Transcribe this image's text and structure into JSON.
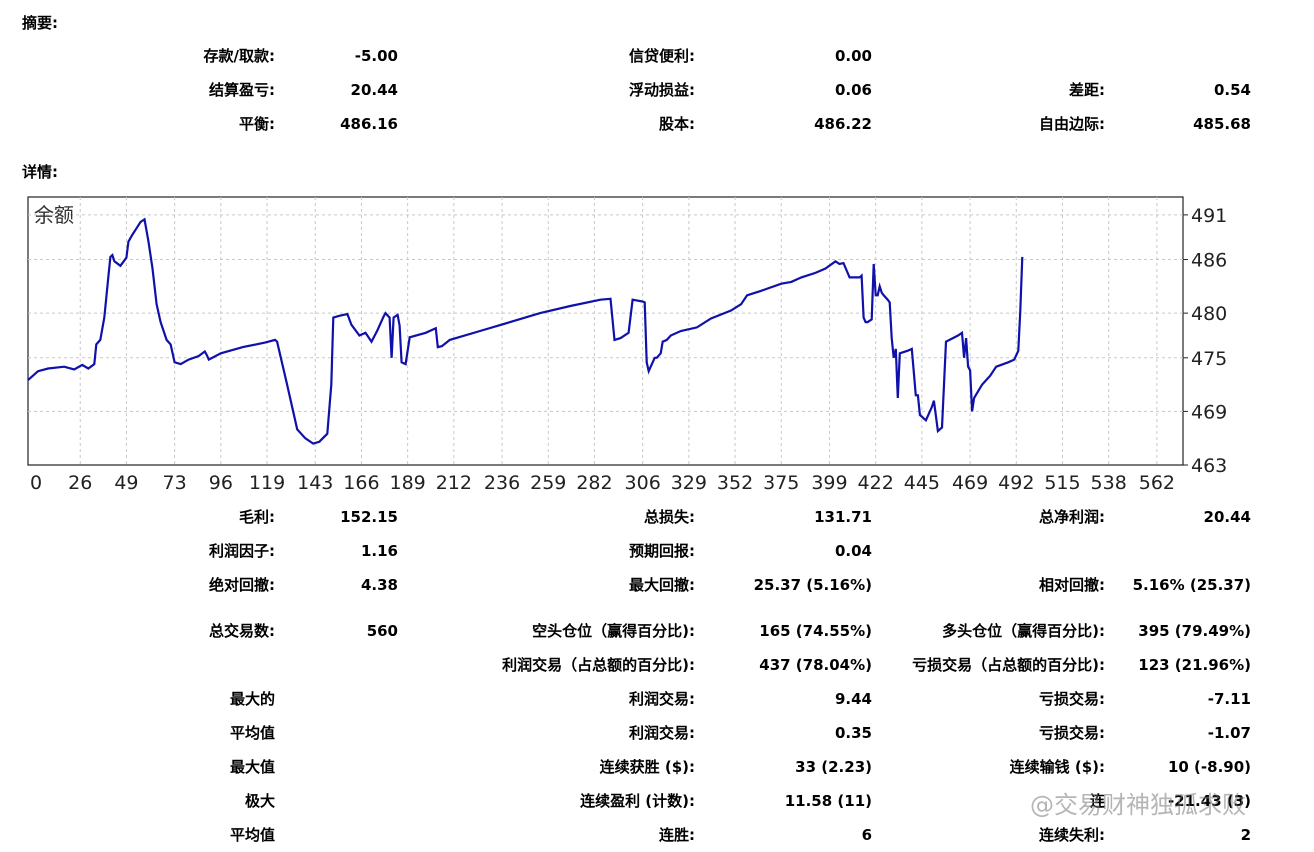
{
  "summary": {
    "heading": "摘要:",
    "rows": [
      [
        {
          "label": "存款/取款:",
          "value": "-5.00"
        },
        {
          "label": "信贷便利:",
          "value": "0.00"
        },
        {
          "label": "",
          "value": ""
        }
      ],
      [
        {
          "label": "结算盈亏:",
          "value": "20.44"
        },
        {
          "label": "浮动损益:",
          "value": "0.06"
        },
        {
          "label": "差距:",
          "value": "0.54"
        }
      ],
      [
        {
          "label": "平衡:",
          "value": "486.16"
        },
        {
          "label": "股本:",
          "value": "486.22"
        },
        {
          "label": "自由边际:",
          "value": "485.68"
        }
      ]
    ]
  },
  "details": {
    "heading": "详情:",
    "rows": [
      [
        {
          "label": "毛利:",
          "value": "152.15"
        },
        {
          "label": "总损失:",
          "value": "131.71"
        },
        {
          "label": "总净利润:",
          "value": "20.44"
        }
      ],
      [
        {
          "label": "利润因子:",
          "value": "1.16"
        },
        {
          "label": "预期回报:",
          "value": "0.04"
        },
        {
          "label": "",
          "value": ""
        }
      ],
      [
        {
          "label": "绝对回撤:",
          "value": "4.38"
        },
        {
          "label": "最大回撤:",
          "value": "25.37 (5.16%)"
        },
        {
          "label": "相对回撤:",
          "value": "5.16% (25.37)"
        }
      ],
      [
        {
          "label": "总交易数:",
          "value": "560"
        },
        {
          "label": "空头仓位（赢得百分比):",
          "value": "165 (74.55%)"
        },
        {
          "label": "多头仓位（赢得百分比):",
          "value": "395 (79.49%)"
        }
      ],
      [
        {
          "label": "",
          "value": ""
        },
        {
          "label": "利润交易（占总额的百分比):",
          "value": "437 (78.04%)"
        },
        {
          "label": "亏损交易（占总额的百分比):",
          "value": "123 (21.96%)"
        }
      ],
      [
        {
          "label": "最大的",
          "value": ""
        },
        {
          "label": "利润交易:",
          "value": "9.44"
        },
        {
          "label": "亏损交易:",
          "value": "-7.11"
        }
      ],
      [
        {
          "label": "平均值",
          "value": ""
        },
        {
          "label": "利润交易:",
          "value": "0.35"
        },
        {
          "label": "亏损交易:",
          "value": "-1.07"
        }
      ],
      [
        {
          "label": "最大值",
          "value": ""
        },
        {
          "label": "连续获胜 ($):",
          "value": "33 (2.23)"
        },
        {
          "label": "连续输钱 ($):",
          "value": "10 (-8.90)"
        }
      ],
      [
        {
          "label": "极大",
          "value": ""
        },
        {
          "label": "连续盈利 (计数):",
          "value": "11.58 (11)"
        },
        {
          "label": "连",
          "value": "-21.43 (3)"
        }
      ],
      [
        {
          "label": "平均值",
          "value": ""
        },
        {
          "label": "连胜:",
          "value": "6"
        },
        {
          "label": "连续失利:",
          "value": "2"
        }
      ]
    ]
  },
  "watermark": "@交易财神独孤求败",
  "chart_data": {
    "type": "line",
    "title": "余额",
    "line_color": "#1010aa",
    "grid": true,
    "xlim": [
      0,
      575
    ],
    "ylim": [
      463,
      493
    ],
    "x_ticks": [
      "0",
      "26",
      "49",
      "73",
      "96",
      "119",
      "143",
      "166",
      "189",
      "212",
      "236",
      "259",
      "282",
      "306",
      "329",
      "352",
      "375",
      "399",
      "422",
      "445",
      "469",
      "492",
      "515",
      "538",
      "562"
    ],
    "y_ticks": [
      463,
      469,
      475,
      480,
      486,
      491
    ],
    "series": [
      {
        "name": "",
        "points": [
          [
            0,
            472.5
          ],
          [
            5,
            473.5
          ],
          [
            10,
            473.8
          ],
          [
            18,
            474
          ],
          [
            23,
            473.7
          ],
          [
            27,
            474.2
          ],
          [
            30,
            473.8
          ],
          [
            33,
            474.3
          ],
          [
            34,
            476.5
          ],
          [
            36,
            477
          ],
          [
            38,
            479.5
          ],
          [
            40,
            484
          ],
          [
            41,
            486.3
          ],
          [
            42,
            486.5
          ],
          [
            43,
            485.8
          ],
          [
            46,
            485.3
          ],
          [
            49,
            486.2
          ],
          [
            50,
            488
          ],
          [
            52,
            488.8
          ],
          [
            54,
            489.5
          ],
          [
            56,
            490.2
          ],
          [
            58,
            490.5
          ],
          [
            60,
            488
          ],
          [
            62,
            485
          ],
          [
            64,
            481
          ],
          [
            66,
            479
          ],
          [
            69,
            477
          ],
          [
            71,
            476.5
          ],
          [
            73,
            474.5
          ],
          [
            76,
            474.3
          ],
          [
            80,
            474.8
          ],
          [
            85,
            475.2
          ],
          [
            88,
            475.7
          ],
          [
            89,
            475.3
          ],
          [
            90,
            474.8
          ],
          [
            96,
            475.5
          ],
          [
            107,
            476.2
          ],
          [
            118,
            476.7
          ],
          [
            123,
            477
          ],
          [
            124,
            476.8
          ],
          [
            129,
            472
          ],
          [
            134,
            467
          ],
          [
            138,
            466
          ],
          [
            142,
            465.4
          ],
          [
            145,
            465.6
          ],
          [
            149,
            466.5
          ],
          [
            151,
            472
          ],
          [
            152,
            479.5
          ],
          [
            155,
            479.7
          ],
          [
            159,
            479.9
          ],
          [
            161,
            478.7
          ],
          [
            163,
            478.1
          ],
          [
            165,
            477.5
          ],
          [
            168,
            477.8
          ],
          [
            171,
            476.8
          ],
          [
            174,
            478.1
          ],
          [
            177,
            479.6
          ],
          [
            178,
            480
          ],
          [
            180,
            479.5
          ],
          [
            181,
            475
          ],
          [
            182,
            479.5
          ],
          [
            184,
            479.8
          ],
          [
            185,
            478.6
          ],
          [
            186,
            474.5
          ],
          [
            188,
            474.3
          ],
          [
            190,
            477.3
          ],
          [
            198,
            477.8
          ],
          [
            203,
            478.3
          ],
          [
            204,
            476.2
          ],
          [
            206,
            476.3
          ],
          [
            210,
            477
          ],
          [
            225,
            478
          ],
          [
            240,
            479
          ],
          [
            255,
            480
          ],
          [
            270,
            480.8
          ],
          [
            285,
            481.5
          ],
          [
            290,
            481.6
          ],
          [
            292,
            477
          ],
          [
            295,
            477.2
          ],
          [
            299,
            477.8
          ],
          [
            301,
            481.5
          ],
          [
            306,
            481.3
          ],
          [
            307,
            481.2
          ],
          [
            308,
            474.5
          ],
          [
            309,
            473.5
          ],
          [
            310,
            474
          ],
          [
            312,
            475
          ],
          [
            313,
            475
          ],
          [
            315,
            475.5
          ],
          [
            316,
            476.8
          ],
          [
            318,
            477
          ],
          [
            320,
            477.5
          ],
          [
            325,
            478
          ],
          [
            333,
            478.4
          ],
          [
            340,
            479.4
          ],
          [
            350,
            480.3
          ],
          [
            355,
            481
          ],
          [
            358,
            482
          ],
          [
            365,
            482.5
          ],
          [
            375,
            483.3
          ],
          [
            380,
            483.5
          ],
          [
            385,
            484
          ],
          [
            392,
            484.5
          ],
          [
            397,
            485
          ],
          [
            402,
            485.8
          ],
          [
            404,
            485.5
          ],
          [
            406,
            485.6
          ],
          [
            409,
            484
          ],
          [
            414,
            484
          ],
          [
            415,
            484.2
          ],
          [
            416,
            479.5
          ],
          [
            417,
            479
          ],
          [
            418,
            479
          ],
          [
            420,
            479.3
          ],
          [
            421,
            485.5
          ],
          [
            422,
            482
          ],
          [
            423,
            482
          ],
          [
            424,
            483
          ],
          [
            425,
            482.3
          ],
          [
            426,
            482
          ],
          [
            428,
            481.5
          ],
          [
            429,
            481.2
          ],
          [
            430,
            477.2
          ],
          [
            431,
            475
          ],
          [
            432,
            476
          ],
          [
            433,
            470.5
          ],
          [
            434,
            475.5
          ],
          [
            438,
            475.8
          ],
          [
            440,
            476
          ],
          [
            442,
            470.8
          ],
          [
            443,
            470.8
          ],
          [
            444,
            468.6
          ],
          [
            447,
            468
          ],
          [
            450,
            469.5
          ],
          [
            451,
            470.2
          ],
          [
            453,
            466.8
          ],
          [
            455,
            467.2
          ],
          [
            457,
            476.8
          ],
          [
            463,
            477.5
          ],
          [
            465,
            477.8
          ],
          [
            466,
            475
          ],
          [
            467,
            477.2
          ],
          [
            468,
            474
          ],
          [
            469,
            473.6
          ],
          [
            470,
            469
          ],
          [
            471,
            470.5
          ],
          [
            475,
            472
          ],
          [
            479,
            473
          ],
          [
            482,
            474
          ],
          [
            488,
            474.5
          ],
          [
            491,
            474.8
          ],
          [
            493,
            475.8
          ],
          [
            494,
            480.3
          ],
          [
            495,
            486.3
          ]
        ]
      }
    ]
  }
}
